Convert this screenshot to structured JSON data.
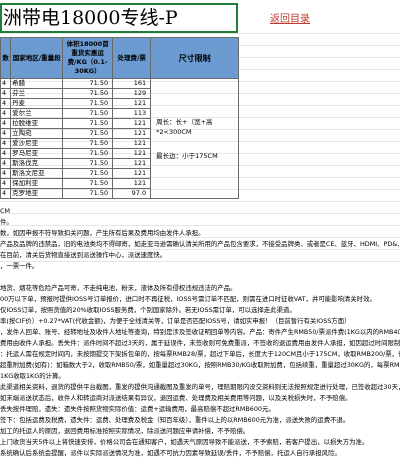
{
  "title": "洲带电18000专线-P",
  "return_link": "返回目录",
  "table": {
    "headers": {
      "col0": "数",
      "zone": "国家地区/重量段",
      "fee": "体积18000首重货实惠运费/KG（0.1-30KG）",
      "handling": "处理费/票",
      "size": "尺寸限制"
    },
    "rows": [
      {
        "num": "4",
        "zone": "希腊",
        "fee": "71.50",
        "handling": "161"
      },
      {
        "num": "4",
        "zone": "芬兰",
        "fee": "71.50",
        "handling": "129"
      },
      {
        "num": "4",
        "zone": "丹麦",
        "fee": "71.50",
        "handling": "121"
      },
      {
        "num": "4",
        "zone": "爱尔兰",
        "fee": "71.50",
        "handling": "113"
      },
      {
        "num": "4",
        "zone": "拉脱维亚",
        "fee": "71.50",
        "handling": "121"
      },
      {
        "num": "4",
        "zone": "立陶宛",
        "fee": "71.50",
        "handling": "121"
      },
      {
        "num": "4",
        "zone": "爱沙尼亚",
        "fee": "71.50",
        "handling": "121"
      },
      {
        "num": "4",
        "zone": "罗马尼亚",
        "fee": "71.50",
        "handling": "121"
      },
      {
        "num": "4",
        "zone": "斯洛伐克",
        "fee": "71.50",
        "handling": "121"
      },
      {
        "num": "4",
        "zone": "斯洛文尼亚",
        "fee": "71.50",
        "handling": "121"
      },
      {
        "num": "4",
        "zone": "保加利亚",
        "fee": "71.50",
        "handling": "121"
      },
      {
        "num": "4",
        "zone": "克罗地亚",
        "fee": "71.50",
        "handling": "97.0"
      }
    ],
    "size_limit": {
      "line1": "周长：长+（宽+高",
      "line2": "*2<300CM",
      "line3": "最长边：小于175CM"
    }
  },
  "notes": [
    "CM",
    "件。",
    "数，如因申报不符导致扣关问题，产生所有后果及费用均由发件人承担。",
    "产品及品牌的违禁品，旧的电池类均不得邮寄，如走亚马逊需确认清关所用的产品包含要求，不接受品牌类、或者是CE、蓝牙、HDMI、PD&、FCC、Lacey Act、DOT等认证。",
    "在目前，清关后货物直接送到派送操作中心，派送速度快。",
    "，一票一件。",
    "",
    "地货、烟花等危险产品可寄，不走纯电池，粉末，液体及所有侵权违规违法的产品。",
    "00万以下单，预报时提供IOSS号订单报价，进口时不再征税，IOSS号需订单不匹配，则需在进口时征收VAT，并可能影响清关时效。",
    "仅IOSS订单，按照货值的20%收取IOSS服务费，个别国家除外。若无IOSS需订单，可以选择走此渠道。",
    "率(按CIF价）+0.27*VAT(代收金额)，为便于全线清关等，订单是否匹配IOSS号，请如实申报！（目前暂行有关IOSS方面）",
    "，发件人回单、账号、经转地址及收件人地址等查询，特别是涉及签收证明回单等内容。产品：寄件产生RMB50/票派件费(1KG以内的RMB40/票)，",
    "费用由收件人承担。丢失件：派件时间不超过3天的，属于延误件，未签收则可免费重派，不签收的退运费用由发件人承担，如因超过时间限制导致派件失败无法派送，则按实际发生运费补偿，",
    "：托运人需在规定时间内，未按期提交下架拆包单的，按每票RMB28/票，超过下单后，长度大于120CM且小于175CM，收取RMB200/票，长度大于175CM，不予承运。",
    "超重附加费(如有)：如箱数大于2，收取RMB50/票，如重量超过30KG，按照RMB30/KG收取附加费，包括续重，重量超过30KG的，每票RMB500/票。",
    "1KG收取1KG的计算。",
    "此渠道相关资料，退货的提供平台截图，重发的提供沟通截图及重发的单号，理赔期限内没交资料则无法按照规定进行处理，已签收超过30天，超过30天不再受理。",
    "如末端派送状态后，收件人和转运商对派送结果有异议，退回运费、处理费及相关费用等问题，以及关税损失时，不予赔偿。",
    "丢失按件理赔，遗失：遗失件按照货物实际价值：运费+运输费用，最高赔偿不超过RMB600元。",
    "签下：包括运费及税费，遗失件：运费、处理费及税金（知百年级），重件以上的以RMB600元为准，派送失败的运费不退。",
    "加工的托运人的原因，退回费用标准按照实际情况，除派送问题应申请补偿，不予赔偿。",
    "上门收货当天5件以上将快速安排，价格公司会在通知客户，如遇天气原因导致不能派送，不予索赔，若客户提出，以损失方为准。",
    "系统确认后系统会提醒，派件以实际派送情况为准，如遇不可抗力因素导致延误/丢件，不予赔偿，托运人自行承担风险。"
  ],
  "colors": {
    "title_border": "#1f7f3a",
    "header_fill": "#6c9bd2",
    "link": "#c0392b"
  }
}
